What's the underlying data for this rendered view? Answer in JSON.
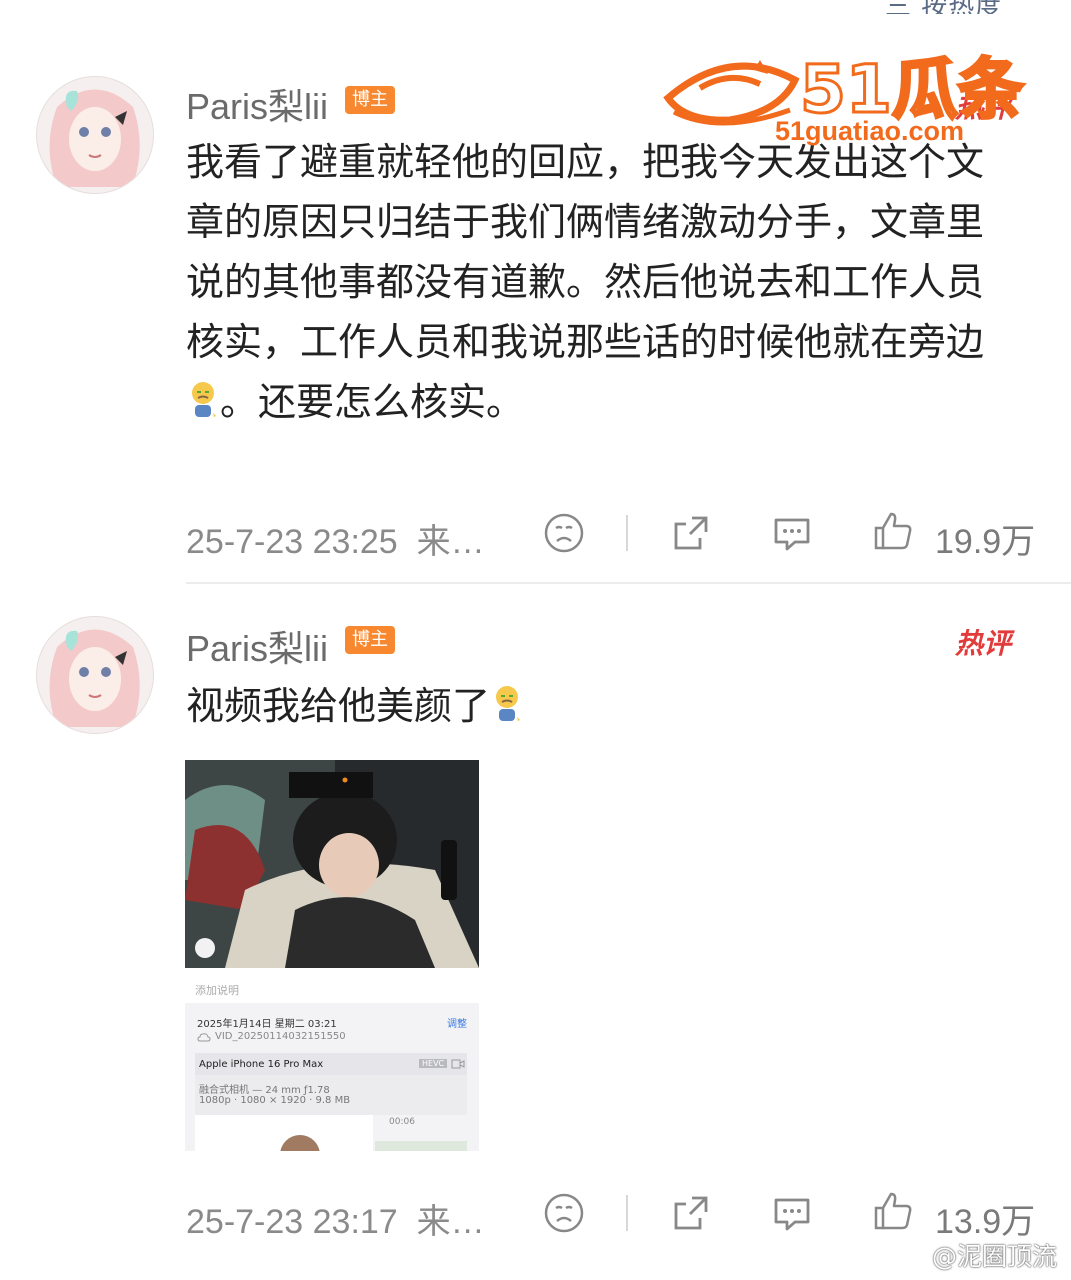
{
  "header": {
    "sort_label": "三 按热度"
  },
  "watermark": {
    "logo_text": "51瓜条",
    "url": "51guatiao.com",
    "bottom_credit": "@泥圈顶流",
    "brand_color": "#f26a1b"
  },
  "comments": [
    {
      "username": "Paris梨lii",
      "badge": "博主",
      "hot_tag": "热评",
      "text_before_emoji": "我看了避重就轻他的回应，把我今天发出这个文章的原因只归结于我们俩情绪激动分手，文章里说的其他事都没有道歉。然后他说去和工作人员核实，工作人员和我说那些话的时候他就在旁边",
      "text_after_emoji": "。还要怎么核实。",
      "timestamp": "25-7-23 23:25",
      "source": "来…",
      "like_count": "19.9万"
    },
    {
      "username": "Paris梨lii",
      "badge": "博主",
      "hot_tag": "热评",
      "text_before_emoji": "视频我给他美颜了",
      "text_after_emoji": "",
      "timestamp": "25-7-23 23:17",
      "source": "来…",
      "like_count": "13.9万",
      "screenshot_card": {
        "caption_placeholder": "添加说明",
        "date_line": "2025年1月14日 星期二 03:21",
        "adjust_label": "调整",
        "file_name": "VID_20250114032151550",
        "device": "Apple iPhone 16 Pro Max",
        "format_badge": "HEVC",
        "lens": "融合式相机 — 24 mm ƒ1.78",
        "specs": "1080p · 1080 × 1920 · 9.8 MB",
        "duration": "00:06"
      }
    }
  ],
  "colors": {
    "badge": "#f7882f",
    "hot": "#e23b3b",
    "meta": "#8a8a8a"
  }
}
